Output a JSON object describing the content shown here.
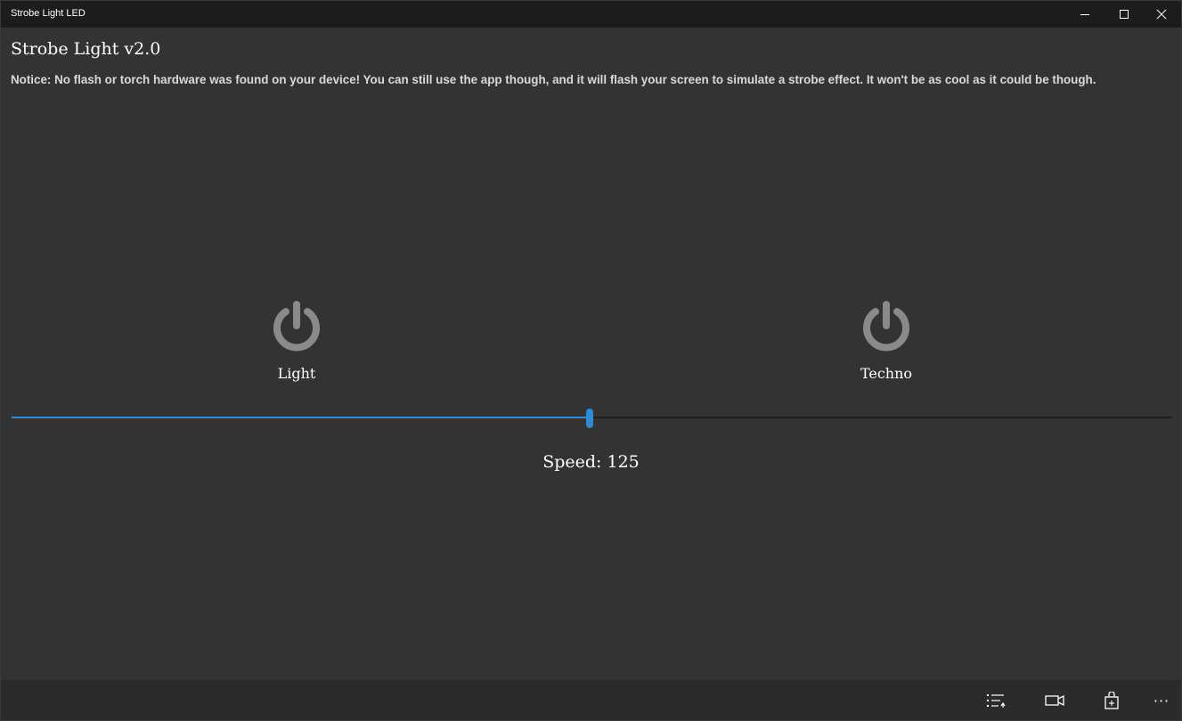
{
  "window": {
    "title": "Strobe Light LED"
  },
  "app": {
    "title": "Strobe Light v2.0",
    "notice": "Notice: No flash or torch hardware was found on your device!  You can still use the app though, and it will flash your screen to simulate a strobe effect.  It won't be as cool as it could be though."
  },
  "buttons": {
    "light": {
      "label": "Light",
      "icon": "power-icon"
    },
    "techno": {
      "label": "Techno",
      "icon": "power-icon"
    }
  },
  "speed": {
    "label": "Speed: 125",
    "value": 125,
    "slider_fraction": 0.498
  },
  "command_bar": {
    "items": [
      "list-icon",
      "video-camera-icon",
      "shopping-bag-icon",
      "more-icon"
    ]
  },
  "colors": {
    "accent": "#2f8bd1",
    "background": "#333333",
    "titlebar": "#1c1c1c",
    "icon_gray": "#8a8a8a"
  }
}
